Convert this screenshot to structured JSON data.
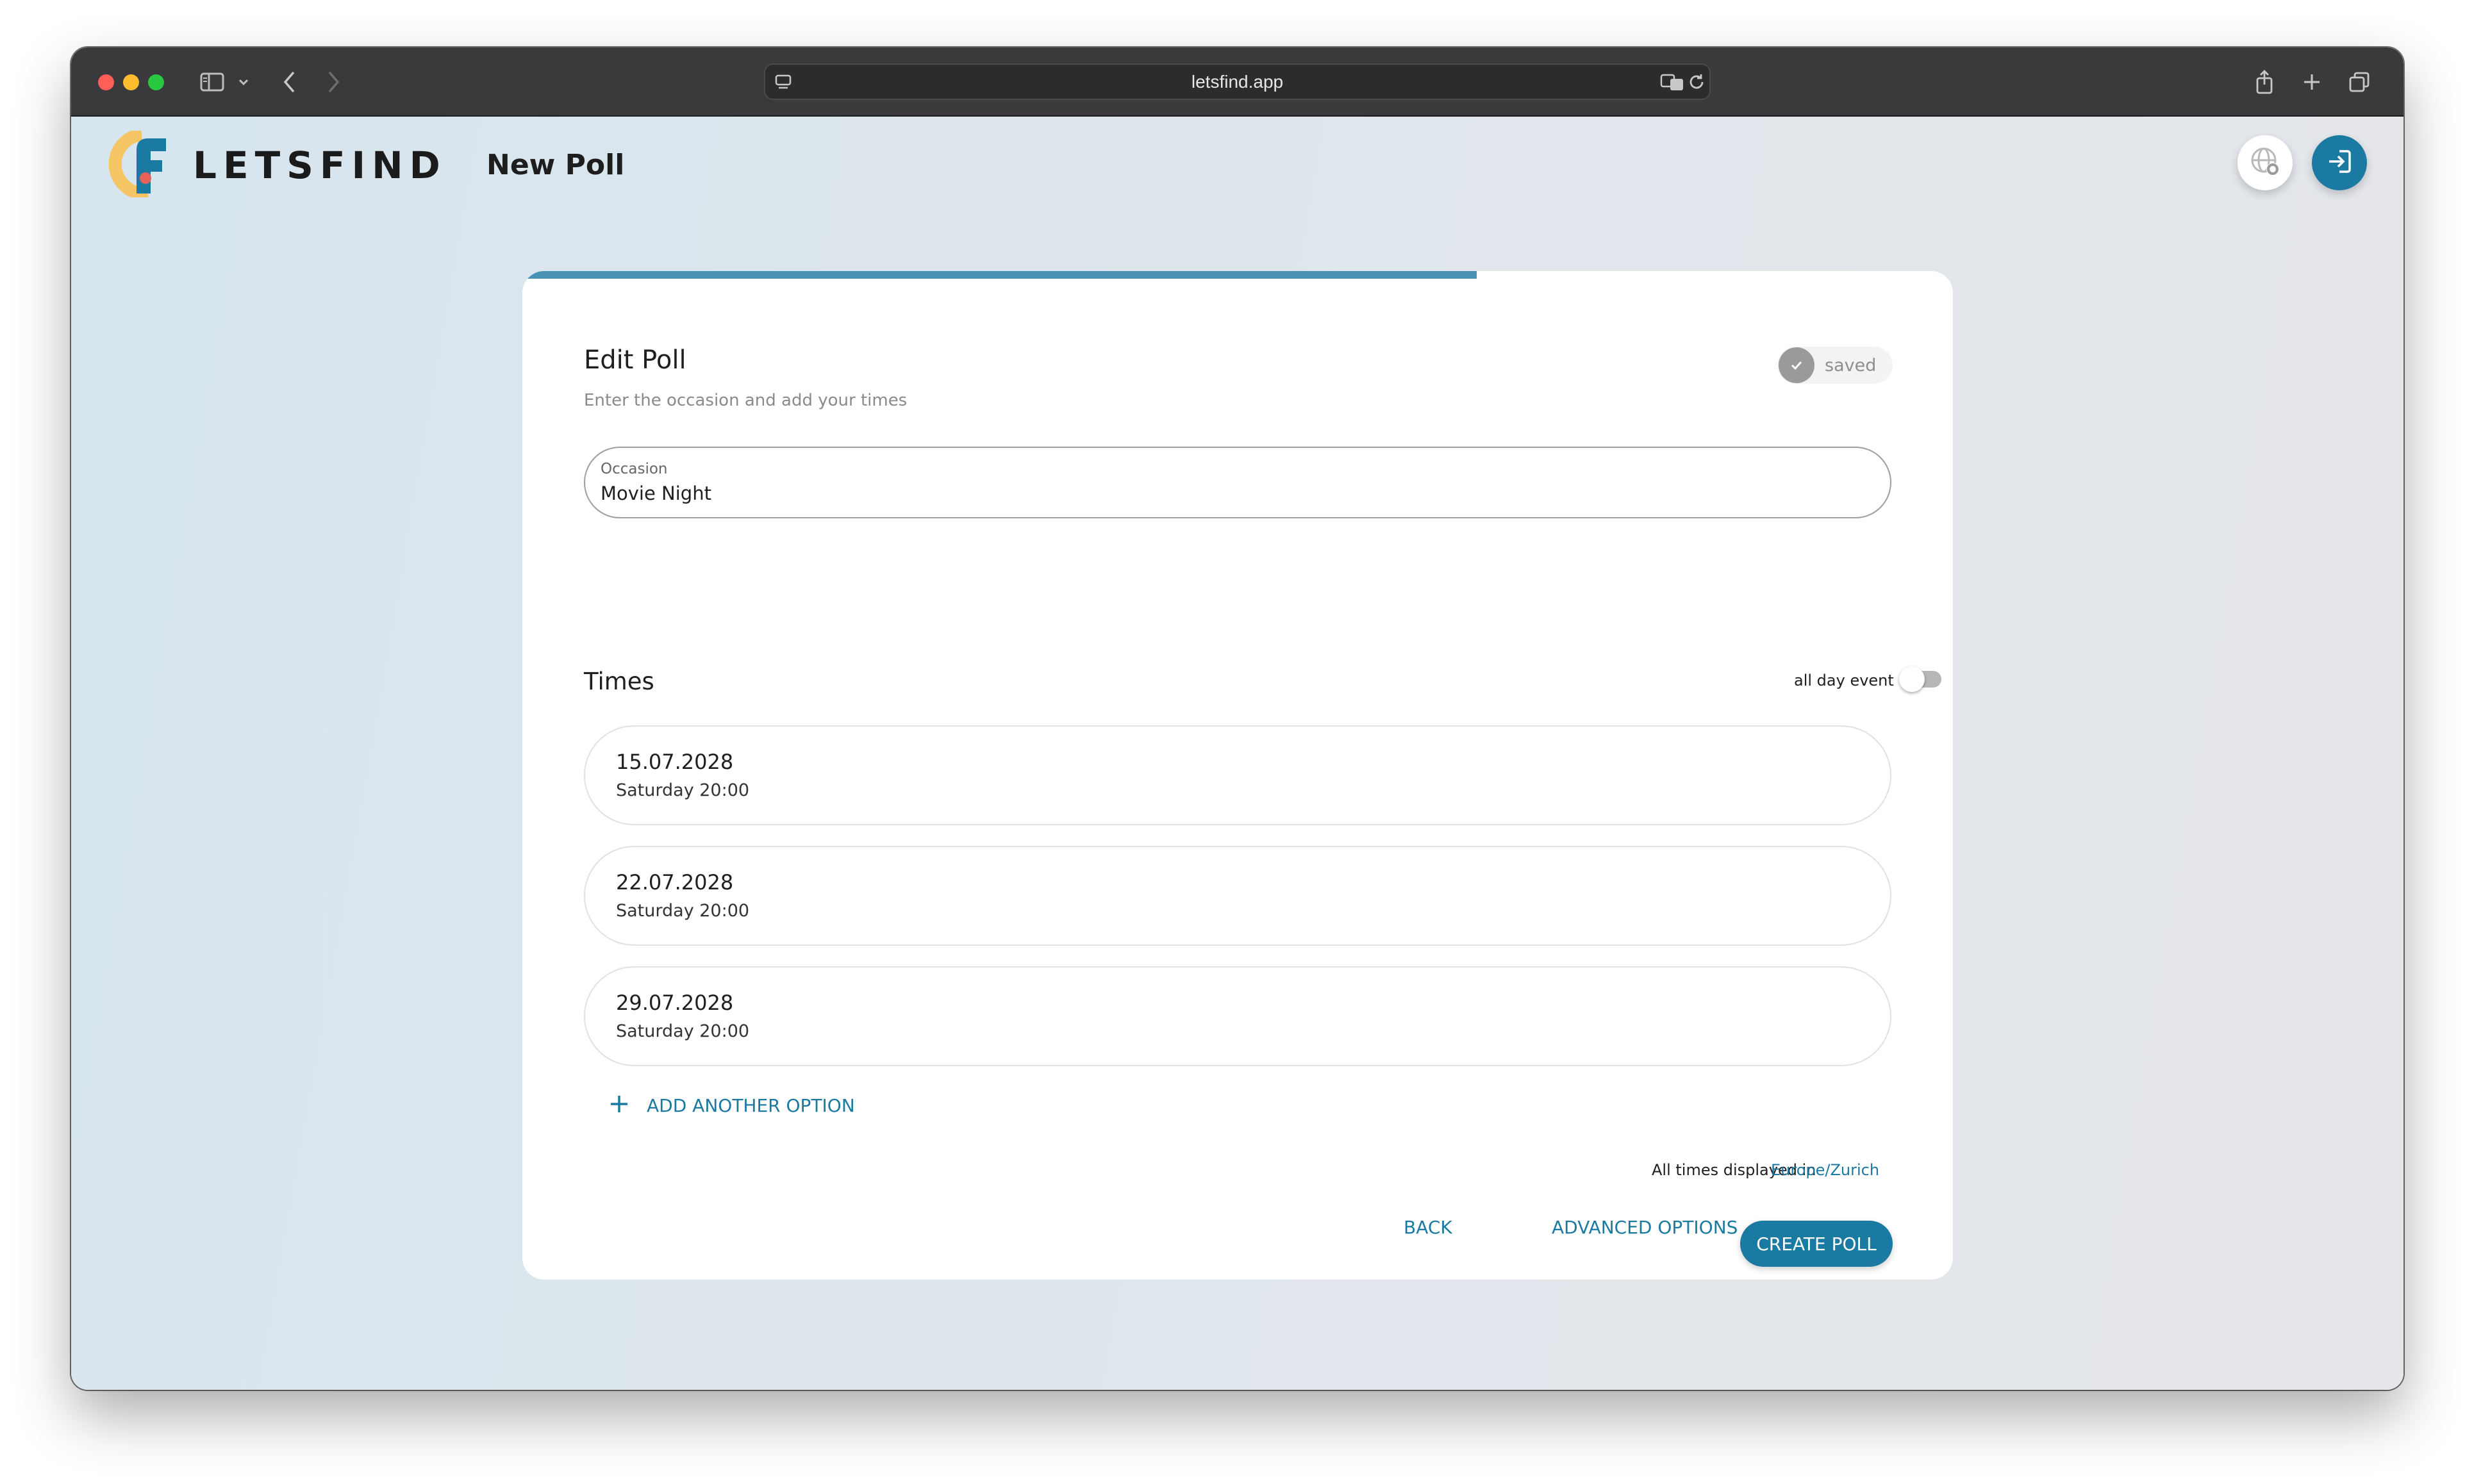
{
  "browser": {
    "url": "letsfind.app"
  },
  "header": {
    "brand": "LETSFIND",
    "page_title": "New Poll"
  },
  "wizard": {
    "progress": 0.667
  },
  "card": {
    "title": "Edit Poll",
    "subtitle": "Enter the occasion and add your times",
    "saved_label": "saved"
  },
  "occasion": {
    "label": "Occasion",
    "value": "Movie Night"
  },
  "times": {
    "title": "Times",
    "all_day_label": "all day event",
    "all_day_enabled": false,
    "options": [
      {
        "date": "15.07.2028",
        "day_time": "Saturday 20:00"
      },
      {
        "date": "22.07.2028",
        "day_time": "Saturday 20:00"
      },
      {
        "date": "29.07.2028",
        "day_time": "Saturday 20:00"
      }
    ],
    "add_label": "ADD ANOTHER OPTION"
  },
  "timezone": {
    "label": "All times displayed in",
    "value": "Europe/Zurich"
  },
  "actions": {
    "back": "BACK",
    "advanced": "ADVANCED OPTIONS",
    "create": "CREATE POLL"
  },
  "colors": {
    "accent": "#1b7aa1",
    "progress": "#4b93b6",
    "background_from": "#d6e5ee",
    "background_to": "#e5e6ea"
  },
  "icons": {
    "language": "globe-gear-icon",
    "login": "login-icon",
    "add": "plus-icon",
    "saved": "check-icon"
  }
}
